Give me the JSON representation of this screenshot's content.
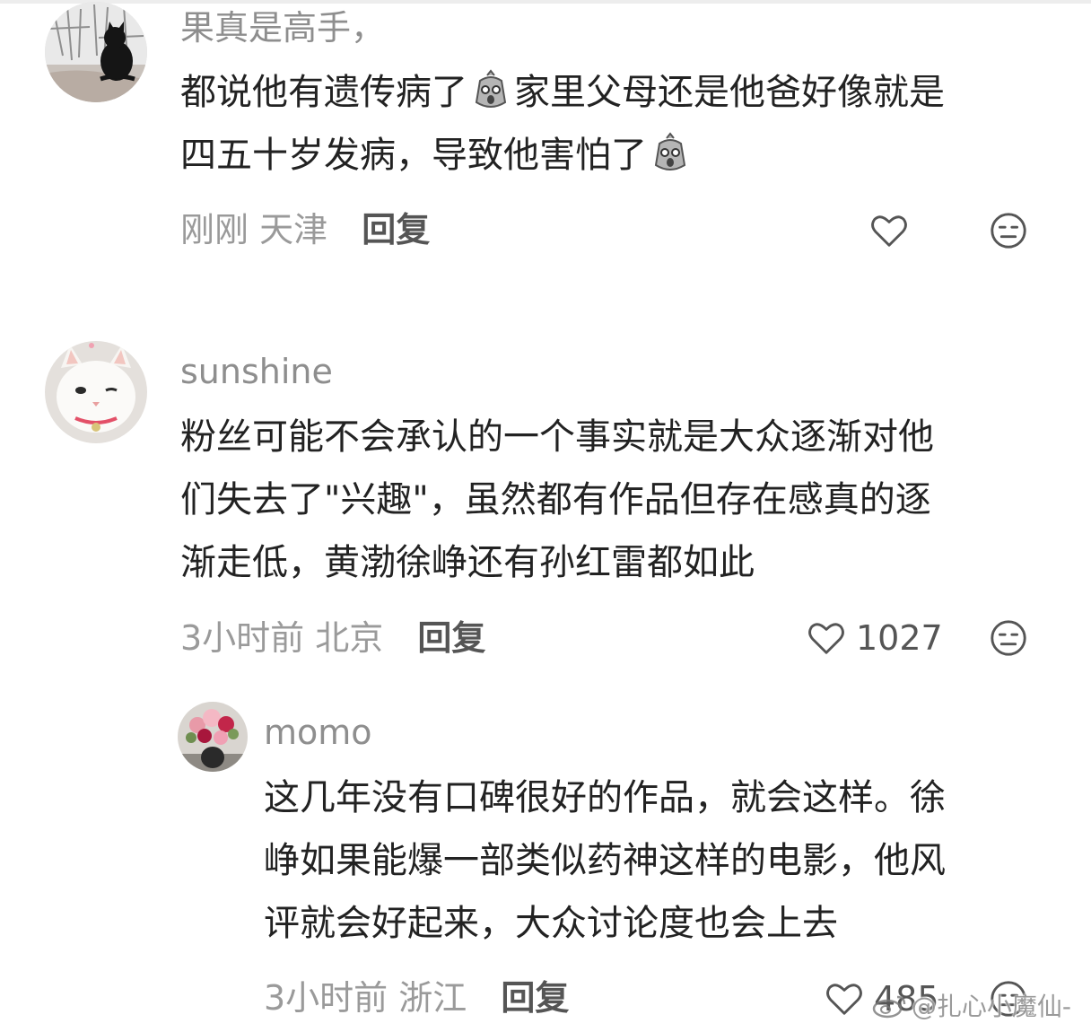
{
  "comments": [
    {
      "username": "果真是高手，",
      "content_lines": [
        "都说他有遗传病了",
        "家里父母还是他爸好像就是",
        "四五十岁发病，导致他害怕了"
      ],
      "time": "刚刚",
      "location": "天津",
      "reply_label": "回复",
      "likes": ""
    },
    {
      "username": "sunshine",
      "content_lines": [
        "粉丝可能不会承认的一个事实就是大众逐渐对他",
        "们失去了\"兴趣\"，虽然都有作品但存在感真的逐",
        "渐走低，黄渤徐峥还有孙红雷都如此"
      ],
      "time": "3小时前",
      "location": "北京",
      "reply_label": "回复",
      "likes": "1027"
    },
    {
      "username": "momo",
      "content_lines": [
        "这几年没有口碑很好的作品，就会这样。徐",
        "峥如果能爆一部类似药神这样的电影，他风",
        "评就会好起来，大众讨论度也会上去"
      ],
      "time": "3小时前",
      "location": "浙江",
      "reply_label": "回复",
      "likes": "485"
    }
  ],
  "watermark": "@扎心小魔仙-",
  "icons": {
    "like": "heart-outline-icon",
    "dislike": "meh-face-icon",
    "emoji": "shocked-bag-emoji-icon"
  },
  "colors": {
    "text": "#222222",
    "secondary": "#9a9a9a",
    "reply": "#555555"
  }
}
